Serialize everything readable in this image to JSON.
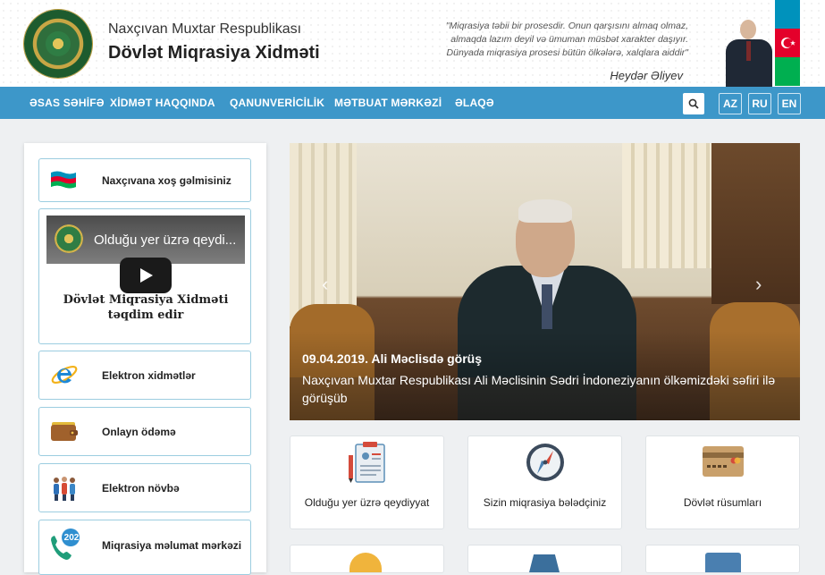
{
  "header": {
    "org_subtitle": "Naxçıvan Muxtar Respublikası",
    "org_title": "Dövlət Miqrasiya Xidməti",
    "quote_lines": [
      "\"Miqrasiya təbii bir prosesdir. Onun qarşısını almaq olmaz,",
      "almaqda lazım deyil və ümuman müsbət xarakter daşıyır.",
      "Dünyada miqrasiya prosesi bütün ölkələrə, xalqlara aiddir\""
    ],
    "quote_author": "Heydər Əliyev"
  },
  "nav": {
    "items": [
      "ƏSAS SƏHİFƏ",
      "XİDMƏT HAQQINDA",
      "QANUNVERİCİLİK",
      "MƏTBUAT MƏRKƏZİ",
      "ƏLAQƏ"
    ],
    "languages": [
      "AZ",
      "RU",
      "EN"
    ]
  },
  "sidebar": {
    "welcome": "Naxçıvana xoş gəlmisiniz",
    "video": {
      "title": "Olduğu yer üzrə qeydi...",
      "caption_line1": "Dövlət Miqrasiya Xidməti",
      "caption_line2": "təqdim edir"
    },
    "items": [
      {
        "label": "Elektron xidmətlər",
        "icon": "internet-explorer-icon"
      },
      {
        "label": "Onlayn ödəmə",
        "icon": "wallet-icon"
      },
      {
        "label": "Elektron növbə",
        "icon": "queue-people-icon"
      },
      {
        "label": "Miqrasiya məlumat mərkəzi",
        "icon": "phone-202-icon",
        "badge": "202"
      }
    ]
  },
  "slider": {
    "date_title": "09.04.2019. Ali Məclisdə görüş",
    "text": "Naxçıvan Muxtar Respublikası Ali Məclisinin Sədri İndoneziyanın ölkəmizdəki səfiri ilə görüşüb"
  },
  "services": [
    {
      "label": "Olduğu yer üzrə qeydiyyat",
      "icon": "clipboard-form-icon"
    },
    {
      "label": "Sizin miqrasiya bələdçiniz",
      "icon": "compass-icon"
    },
    {
      "label": "Dövlət rüsumları",
      "icon": "credit-card-icon"
    }
  ],
  "colors": {
    "nav": "#3d97c9",
    "card_border": "#9ccde0",
    "flag_blue": "#0092bc",
    "flag_red": "#e4002b",
    "flag_green": "#00af50"
  }
}
